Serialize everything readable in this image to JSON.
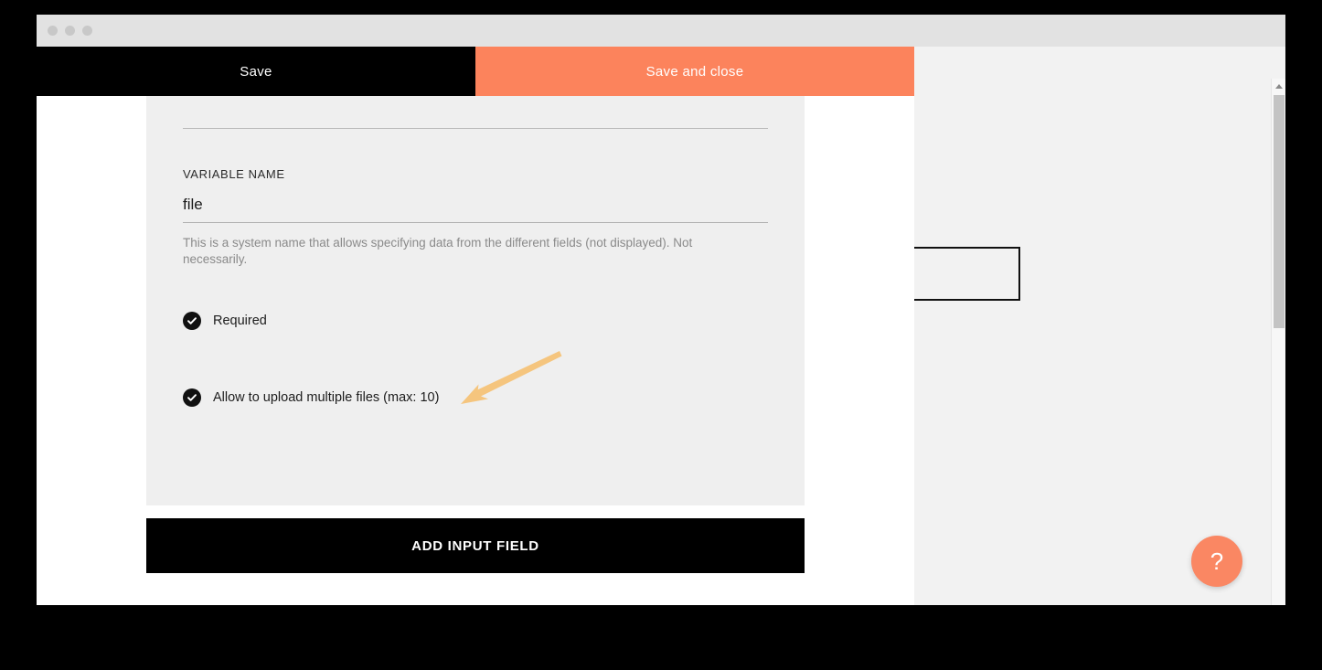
{
  "window": {
    "traffic_lights": [
      "close-dot",
      "minimize-dot",
      "maximize-dot"
    ]
  },
  "modal": {
    "actions": {
      "save_label": "Save",
      "save_and_close_label": "Save and close"
    },
    "field_editor": {
      "variable_name_label": "VARIABLE NAME",
      "variable_name_value": "file",
      "variable_name_placeholder": "Variable name",
      "hint": "This is a system name that allows specifying data from the different fields (not displayed). Not necessarily.",
      "checkboxes": [
        {
          "name": "required",
          "label": "Required",
          "checked": true
        },
        {
          "name": "allow-multiple-files",
          "label": "Allow to upload multiple files (max: 10)",
          "checked": true
        }
      ]
    },
    "add_input_field_label": "ADD INPUT FIELD"
  },
  "help": {
    "icon": "question-mark-icon",
    "label": "?"
  },
  "scrollbar": {
    "up_icon": "chevron-up-icon",
    "down_icon": "chevron-down-icon"
  },
  "annotation": {
    "type": "arrow",
    "points_to": "allow-multiple-files-checkbox-label",
    "color": "#f5c57e"
  },
  "colors": {
    "accent": "#fc835c",
    "help_bubble": "#fa8763",
    "primary_button": "#000000",
    "panel_background": "#efefef",
    "modal_background": "#ffffff",
    "page_background": "#f2f2f2",
    "annotation_arrow": "#f5c57e"
  }
}
